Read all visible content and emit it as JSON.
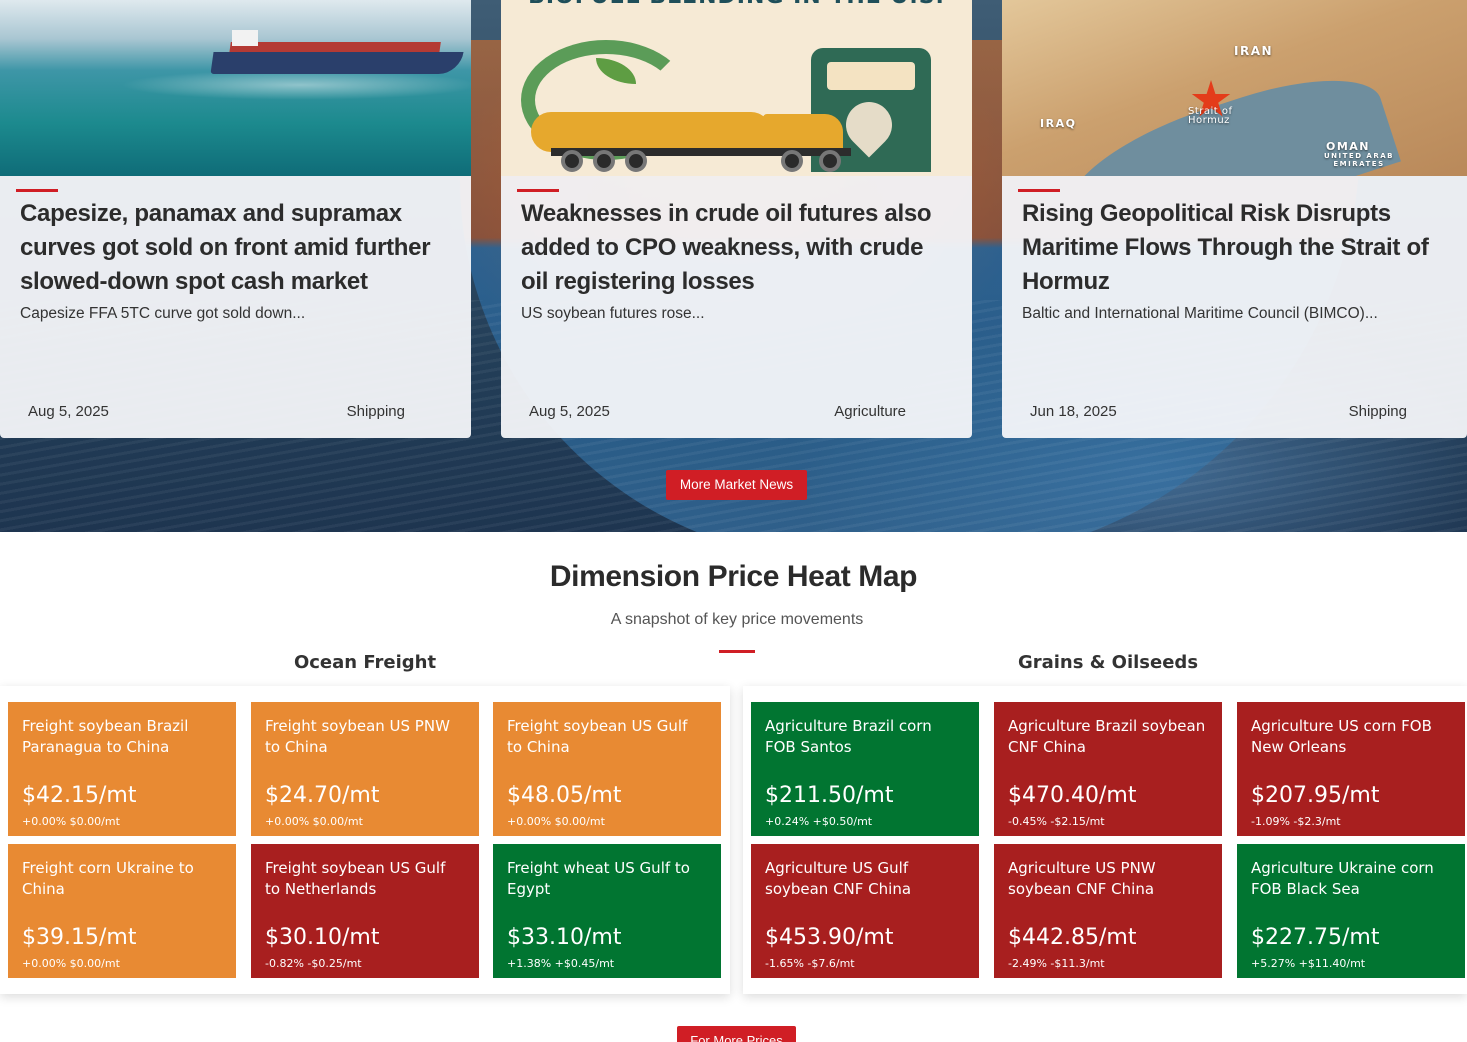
{
  "news": {
    "cards": [
      {
        "title": "Capesize, panamax and supramax curves got sold on front amid further slowed-down spot cash market",
        "excerpt": "Capesize FFA 5TC curve got sold down...",
        "date": "Aug 5, 2025",
        "category": "Shipping"
      },
      {
        "title": "Weaknesses in crude oil futures also added to CPO weakness, with crude oil registering losses",
        "excerpt": "US soybean futures rose...",
        "date": "Aug 5, 2025",
        "category": "Agriculture",
        "image_text": "BIOFUEL BLENDING IN THE U.S."
      },
      {
        "title": "Rising Geopolitical Risk Disrupts Maritime Flows Through the Strait of Hormuz",
        "excerpt": "Baltic and International Maritime Council (BIMCO)...",
        "date": "Jun 18, 2025",
        "category": "Shipping",
        "map_labels": {
          "iran": "IRAN",
          "iraq": "IRAQ",
          "oman": "OMAN",
          "uae": "UNITED ARAB EMIRATES",
          "strait": "Strait of Hormuz"
        }
      }
    ],
    "more_button": "More Market News"
  },
  "heatmap": {
    "title": "Dimension Price Heat Map",
    "subtitle": "A snapshot of key price movements",
    "groups": [
      {
        "name": "Ocean Freight",
        "tiles": [
          {
            "name": "Freight soybean Brazil Paranagua to China",
            "price": "$42.15/mt",
            "change": "+0.00%  $0.00/mt",
            "status": "neutral"
          },
          {
            "name": "Freight soybean US PNW to China",
            "price": "$24.70/mt",
            "change": "+0.00%  $0.00/mt",
            "status": "neutral"
          },
          {
            "name": "Freight soybean US Gulf to China",
            "price": "$48.05/mt",
            "change": "+0.00%  $0.00/mt",
            "status": "neutral"
          },
          {
            "name": "Freight corn Ukraine to China",
            "price": "$39.15/mt",
            "change": "+0.00%  $0.00/mt",
            "status": "neutral"
          },
          {
            "name": "Freight soybean US Gulf to Netherlands",
            "price": "$30.10/mt",
            "change": "-0.82%  -$0.25/mt",
            "status": "down"
          },
          {
            "name": "Freight wheat US Gulf to Egypt",
            "price": "$33.10/mt",
            "change": "+1.38%  +$0.45/mt",
            "status": "up"
          }
        ]
      },
      {
        "name": "Grains & Oilseeds",
        "tiles": [
          {
            "name": "Agriculture Brazil corn FOB Santos",
            "price": "$211.50/mt",
            "change": "+0.24%  +$0.50/mt",
            "status": "up"
          },
          {
            "name": "Agriculture Brazil soybean CNF China",
            "price": "$470.40/mt",
            "change": "-0.45%  -$2.15/mt",
            "status": "down"
          },
          {
            "name": "Agriculture US corn FOB New Orleans",
            "price": "$207.95/mt",
            "change": "-1.09%  -$2.3/mt",
            "status": "down"
          },
          {
            "name": "Agriculture US Gulf soybean CNF China",
            "price": "$453.90/mt",
            "change": "-1.65%  -$7.6/mt",
            "status": "down"
          },
          {
            "name": "Agriculture US PNW soybean CNF China",
            "price": "$442.85/mt",
            "change": "-2.49%  -$11.3/mt",
            "status": "down"
          },
          {
            "name": "Agriculture Ukraine corn FOB Black Sea",
            "price": "$227.75/mt",
            "change": "+5.27%  +$11.40/mt",
            "status": "up"
          }
        ]
      }
    ],
    "more_button": "For More Prices"
  },
  "colors": {
    "accent_red": "#d01e25",
    "neutral_tile": "#e88a33",
    "down_tile": "#a81f1f",
    "up_tile": "#017531"
  }
}
